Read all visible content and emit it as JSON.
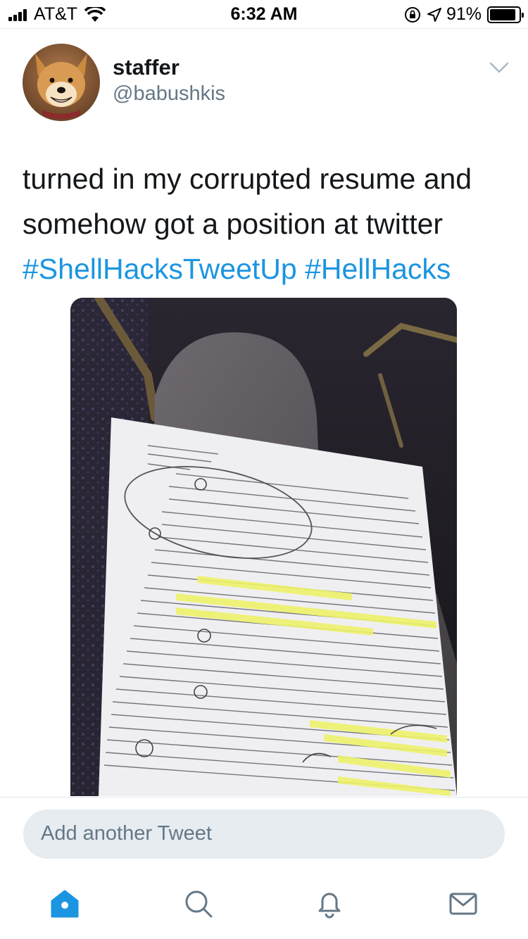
{
  "status_bar": {
    "carrier": "AT&T",
    "time": "6:32 AM",
    "battery_percent": "91%",
    "battery_level": 0.91
  },
  "tweet": {
    "author_name": "staffer",
    "author_handle": "@babushkis",
    "text_lines": [
      "turned in my corrupted resume and",
      "somehow got a position at twitter"
    ],
    "hashtags": [
      "#ShellHacksTweetUp",
      "#HellHacks"
    ]
  },
  "compose": {
    "placeholder": "Add another Tweet"
  },
  "tabbar": {
    "items": [
      "home-icon",
      "search-icon",
      "notifications-icon",
      "messages-icon"
    ],
    "active": "home-icon"
  },
  "colors": {
    "accent": "#1b95e0",
    "text": "#14171a",
    "secondary_text": "#657786",
    "compose_bg": "#e6ecf0"
  }
}
